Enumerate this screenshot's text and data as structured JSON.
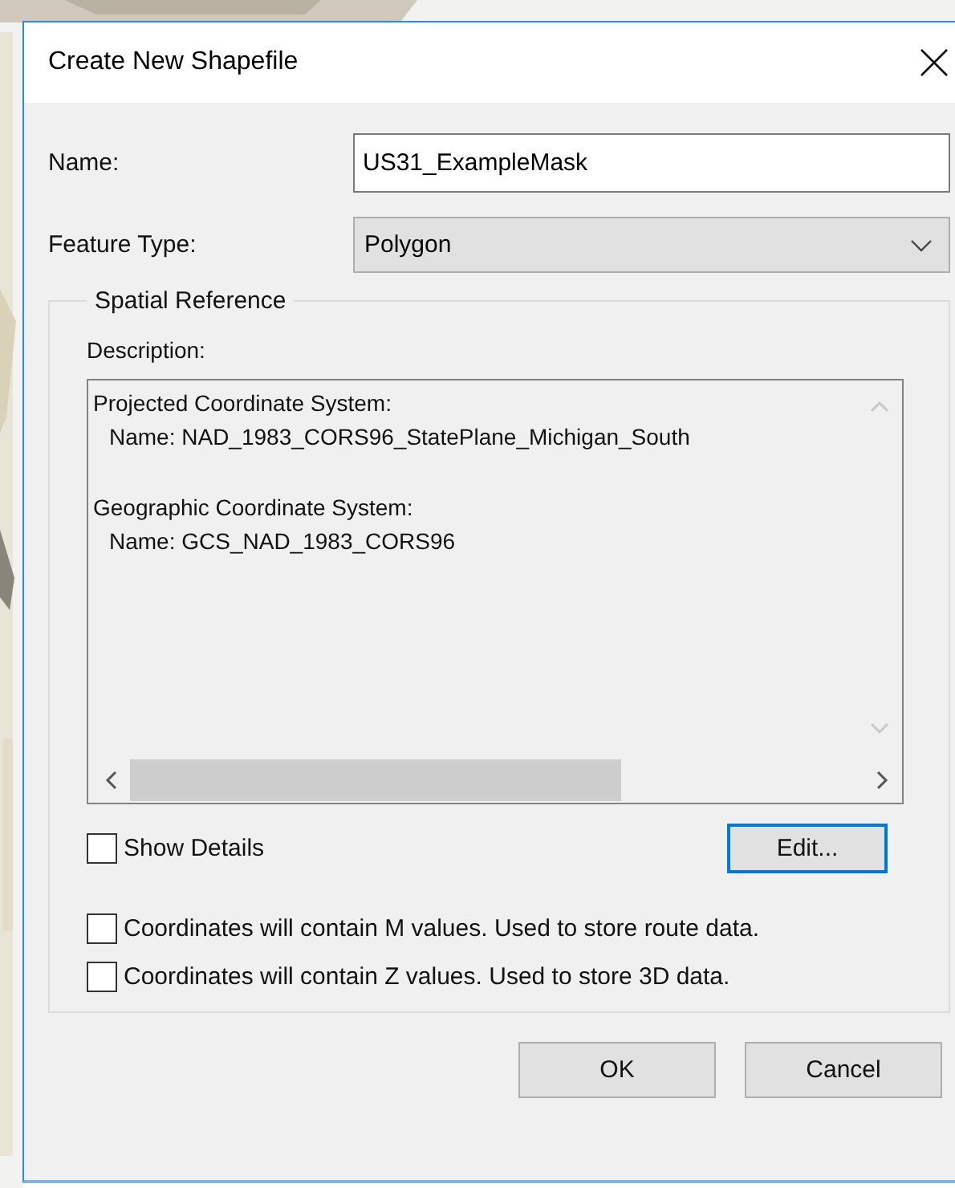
{
  "window": {
    "title": "Create New Shapefile"
  },
  "fields": [
    {
      "kind": "text",
      "label": "Name:",
      "value": "US31_ExampleMask"
    },
    {
      "kind": "combo",
      "label": "Feature Type:",
      "value": "Polygon"
    }
  ],
  "spatial_reference": {
    "caption": "Spatial Reference",
    "description_label": "Description:",
    "description": [
      {
        "heading": "Projected Coordinate System:",
        "lines": [
          "Name: NAD_1983_CORS96_StatePlane_Michigan_South"
        ]
      },
      {
        "heading": "Geographic Coordinate System:",
        "lines": [
          "Name: GCS_NAD_1983_CORS96"
        ]
      }
    ],
    "show_details": {
      "label": "Show Details",
      "checked": false
    },
    "edit_button": {
      "label": "Edit...",
      "focused": true
    },
    "options": [
      {
        "label": "Coordinates will contain M values. Used to store route data.",
        "checked": false
      },
      {
        "label": "Coordinates will contain Z values. Used to store 3D data.",
        "checked": false
      }
    ]
  },
  "buttons": [
    {
      "label": "OK",
      "focused": false
    },
    {
      "label": "Cancel",
      "focused": false
    }
  ]
}
